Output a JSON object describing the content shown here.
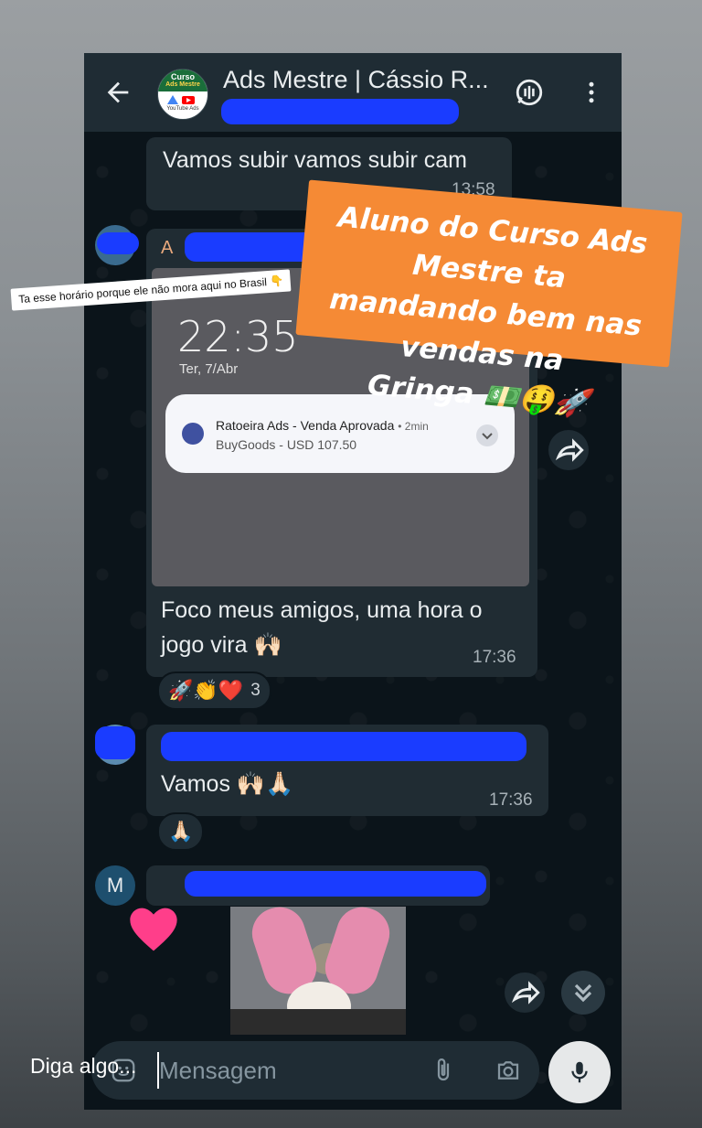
{
  "header": {
    "title": "Ads Mestre | Cássio R...",
    "avatar_line1": "Curso",
    "avatar_line2": "Ads Mestre",
    "avatar_line3": "YouTube Ads"
  },
  "messages": [
    {
      "text": "Vamos subir vamos subir cam",
      "time": "13:58"
    },
    {
      "sender_initial": "A",
      "text_line1": "Foco meus amigos, uma hora o",
      "text_line2": "jogo vira 🙌🏻",
      "time": "17:36"
    },
    {
      "text": "Vamos 🙌🏻🙏🏻",
      "time": "17:36"
    },
    {
      "sender_initial": "M"
    }
  ],
  "notification_image": {
    "clock": "22:35",
    "date": "Ter, 7/Abr",
    "notif_title": "Ratoeira Ads - Venda Aprovada",
    "notif_age": "• 2min",
    "notif_sub": "BuyGoods - USD 107.50"
  },
  "reactions": {
    "first": "🚀👏❤️",
    "first_count": "3",
    "second": "🙏🏻"
  },
  "input": {
    "placeholder": "Mensagem"
  },
  "overlays": {
    "orange_line1": "Aluno do Curso Ads Mestre ta",
    "orange_line2": "mandando bem nas vendas na",
    "orange_line3": "Gringa 💵🤑🚀",
    "white_note": "Ta esse horário porque ele não mora aqui no Brasil 👇",
    "diga": "Diga algo..."
  },
  "colors": {
    "chat_bg": "#0b141a",
    "bubble": "#202c33",
    "header": "#1f2c34",
    "orange": "#f58a35",
    "scribble": "#1a3cff"
  },
  "icons": [
    "back-arrow-icon",
    "voice-chat-icon",
    "more-vert-icon",
    "forward-icon",
    "scroll-down-icon",
    "sticker-icon",
    "attach-icon",
    "camera-icon",
    "mic-icon",
    "heart-sticker"
  ]
}
